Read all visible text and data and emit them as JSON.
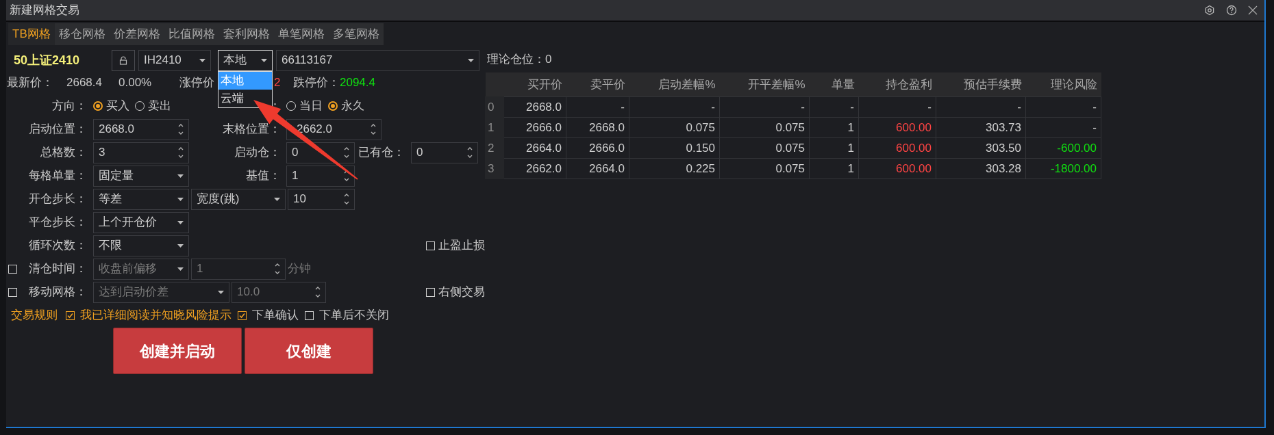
{
  "window": {
    "title": "新建网格交易"
  },
  "tabs": [
    {
      "label": "TB网格",
      "selected": true
    },
    {
      "label": "移仓网格",
      "selected": false
    },
    {
      "label": "价差网格",
      "selected": false
    },
    {
      "label": "比值网格",
      "selected": false
    },
    {
      "label": "套利网格",
      "selected": false
    },
    {
      "label": "单笔网格",
      "selected": false
    },
    {
      "label": "多笔网格",
      "selected": false
    }
  ],
  "contract": {
    "name": "50上证2410",
    "symbol": "IH2410",
    "location": "本地",
    "account": "66113167"
  },
  "location_menu": {
    "options": [
      {
        "label": "本地",
        "selected": true
      },
      {
        "label": "云端",
        "selected": false
      }
    ]
  },
  "quote": {
    "last_label": "最新价：",
    "last": "2668.4",
    "change": "0.00%",
    "limit_up_label": "涨停价",
    "limit_up": "2",
    "limit_down_label": "跌停价：",
    "limit_down": "2094.4"
  },
  "direction": {
    "label": "方向：",
    "options": [
      {
        "label": "买入",
        "selected": true
      },
      {
        "label": "卖出",
        "selected": false
      }
    ]
  },
  "validity": {
    "label": "：",
    "options": [
      {
        "label": "当日",
        "selected": false
      },
      {
        "label": "永久",
        "selected": true
      }
    ]
  },
  "start_price": {
    "label": "启动位置：",
    "value": "2668.0"
  },
  "end_price": {
    "label": "末格位置：",
    "value": "2662.0"
  },
  "grid_count": {
    "label": "总格数：",
    "value": "3"
  },
  "start_position": {
    "label": "启动仓：",
    "value": "0"
  },
  "existing_position": {
    "label": "已有仓：",
    "value": "0"
  },
  "lot_mode": {
    "label": "每格单量：",
    "value": "固定量"
  },
  "base": {
    "label": "基值：",
    "value": "1"
  },
  "open_step": {
    "label": "开仓步长：",
    "mode": "等差",
    "unit": "宽度(跳)",
    "value": "10"
  },
  "close_step": {
    "label": "平仓步长：",
    "value": "上个开仓价"
  },
  "cycles": {
    "label": "循环次数：",
    "value": "不限"
  },
  "take_profit": {
    "label": "止盈止损",
    "checked": false
  },
  "close_time": {
    "label": "清仓时间：",
    "checked": false,
    "disabled": true,
    "mode": "收盘前偏移",
    "value": "1",
    "unit": "分钟"
  },
  "moving_grid": {
    "label": "移动网格：",
    "checked": false,
    "disabled": true,
    "mode": "达到启动价差",
    "value": "10.0"
  },
  "right_side": {
    "label": "右侧交易",
    "checked": false
  },
  "rules": {
    "link": "交易规则",
    "items": [
      {
        "label": "我已详细阅读并知晓风险提示",
        "checked": true,
        "kind": "notice"
      },
      {
        "label": "下单确认",
        "checked": true,
        "kind": "option"
      },
      {
        "label": "下单后不关闭",
        "checked": false,
        "kind": "option"
      }
    ]
  },
  "buttons": [
    "创建并启动",
    "仅创建"
  ],
  "position": {
    "label": "理论仓位：",
    "value": "0"
  },
  "table": {
    "columns": [
      "买开价",
      "卖平价",
      "启动差幅%",
      "开平差幅%",
      "单量",
      "持仓盈利",
      "预估手续费",
      "理论风险"
    ],
    "rows": [
      {
        "index": "0",
        "cells": [
          "2668.0",
          "-",
          "-",
          "-",
          "-",
          "-",
          "-",
          "-"
        ]
      },
      {
        "index": "1",
        "cells": [
          "2666.0",
          "2668.0",
          "0.075",
          "0.075",
          "1",
          {
            "text": "600.00",
            "color": "#ff4444"
          },
          "303.73",
          "-"
        ]
      },
      {
        "index": "2",
        "cells": [
          "2664.0",
          "2666.0",
          "0.150",
          "0.075",
          "1",
          {
            "text": "600.00",
            "color": "#ff4444"
          },
          "303.50",
          {
            "text": "-600.00",
            "color": "#10e010"
          }
        ]
      },
      {
        "index": "3",
        "cells": [
          "2662.0",
          "2664.0",
          "0.225",
          "0.075",
          "1",
          {
            "text": "600.00",
            "color": "#ff4444"
          },
          "303.28",
          {
            "text": "-1800.00",
            "color": "#10e010"
          }
        ]
      }
    ]
  }
}
